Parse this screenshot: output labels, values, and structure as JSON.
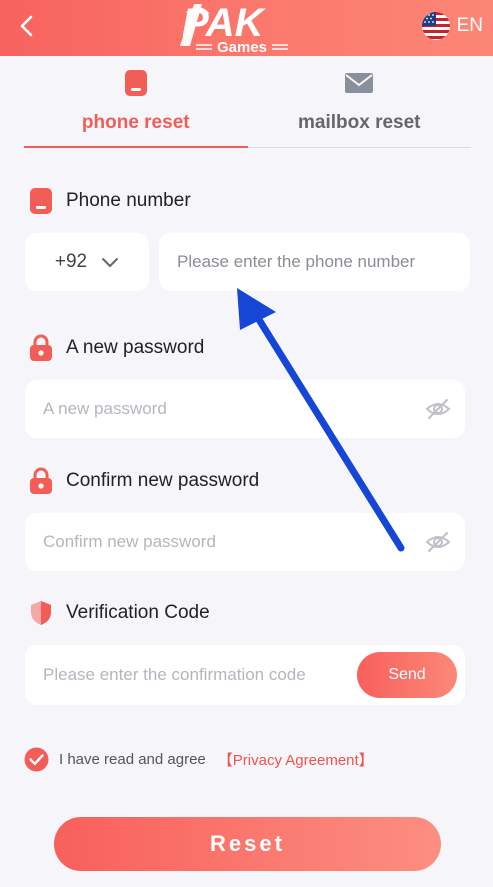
{
  "header": {
    "logo_main": "PAK",
    "logo_sub": "Games",
    "language": "EN"
  },
  "tabs": [
    {
      "label": "phone reset",
      "active": true
    },
    {
      "label": "mailbox reset",
      "active": false
    }
  ],
  "phone": {
    "label": "Phone number",
    "country_code": "+92",
    "placeholder": "Please enter the phone number"
  },
  "new_password": {
    "label": "A new password",
    "placeholder": "A new password"
  },
  "confirm_password": {
    "label": "Confirm new password",
    "placeholder": "Confirm new password"
  },
  "verification": {
    "label": "Verification Code",
    "placeholder": "Please enter the confirmation code",
    "send_label": "Send"
  },
  "agreement": {
    "checked": true,
    "text": "I have read and agree",
    "link": "【Privacy Agreement】"
  },
  "reset_label": "Reset",
  "colors": {
    "accent": "#f25d58",
    "header_start": "#f7635f",
    "header_end": "#fb8676",
    "annotation_arrow": "#1546d6"
  }
}
